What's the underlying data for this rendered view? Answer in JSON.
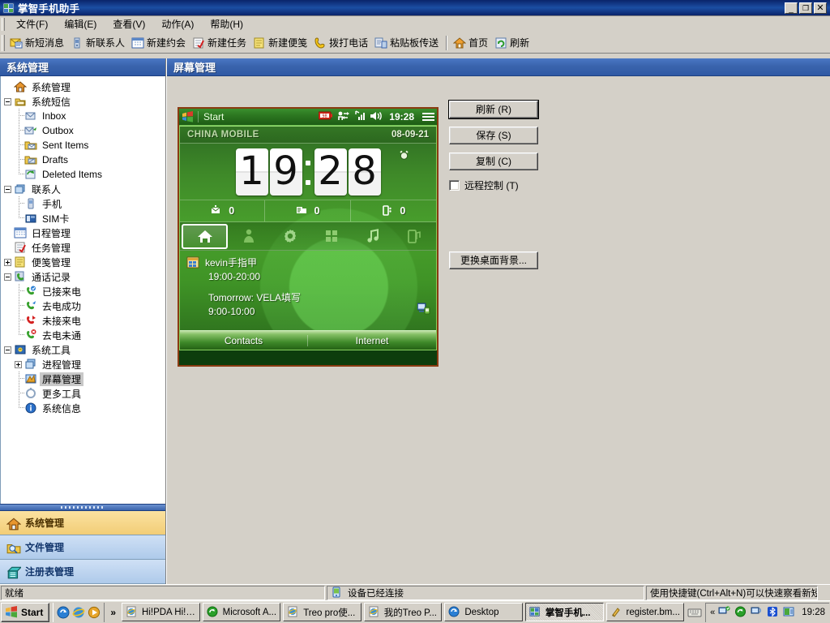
{
  "window": {
    "title": "掌智手机助手",
    "icon": "app-icon",
    "buttons": {
      "minimize": "_",
      "maximize": "❐",
      "close": "✕"
    }
  },
  "menubar": {
    "items": [
      {
        "label": "文件(F)",
        "name": "menu-file"
      },
      {
        "label": "编辑(E)",
        "name": "menu-edit"
      },
      {
        "label": "查看(V)",
        "name": "menu-view"
      },
      {
        "label": "动作(A)",
        "name": "menu-action"
      },
      {
        "label": "帮助(H)",
        "name": "menu-help"
      }
    ]
  },
  "toolbar": {
    "items": [
      {
        "label": "新短消息",
        "icon": "new-sms-icon"
      },
      {
        "label": "新联系人",
        "icon": "new-contact-icon"
      },
      {
        "label": "新建约会",
        "icon": "new-appointment-icon"
      },
      {
        "label": "新建任务",
        "icon": "new-task-icon"
      },
      {
        "label": "新建便笺",
        "icon": "new-note-icon"
      },
      {
        "label": "拨打电话",
        "icon": "dial-phone-icon"
      },
      {
        "label": "粘贴板传送",
        "icon": "clipboard-transfer-icon"
      },
      {
        "label": "首页",
        "icon": "home-icon"
      },
      {
        "label": "刷新",
        "icon": "refresh-icon"
      }
    ]
  },
  "sidebar": {
    "header": "系统管理",
    "tree": [
      {
        "label": "系统管理",
        "indent": 1,
        "icon": "home-house-icon",
        "expander": "none",
        "selected": false
      },
      {
        "label": "系统短信",
        "indent": 1,
        "icon": "sms-folder-icon",
        "expander": "minus",
        "selected": false
      },
      {
        "label": "Inbox",
        "indent": 2,
        "icon": "inbox-icon",
        "expander": "none",
        "selected": false
      },
      {
        "label": "Outbox",
        "indent": 2,
        "icon": "outbox-icon",
        "expander": "none",
        "selected": false
      },
      {
        "label": "Sent Items",
        "indent": 2,
        "icon": "sent-items-icon",
        "expander": "none",
        "selected": false
      },
      {
        "label": "Drafts",
        "indent": 2,
        "icon": "drafts-icon",
        "expander": "none",
        "selected": false
      },
      {
        "label": "Deleted Items",
        "indent": 2,
        "icon": "deleted-items-icon",
        "expander": "none",
        "selected": false
      },
      {
        "label": "联系人",
        "indent": 1,
        "icon": "contacts-icon",
        "expander": "minus",
        "selected": false
      },
      {
        "label": "手机",
        "indent": 2,
        "icon": "phone-icon",
        "expander": "none",
        "selected": false
      },
      {
        "label": "SIM卡",
        "indent": 2,
        "icon": "sim-card-icon",
        "expander": "none",
        "selected": false
      },
      {
        "label": "日程管理",
        "indent": 1,
        "icon": "calendar-icon",
        "expander": "none",
        "selected": false
      },
      {
        "label": "任务管理",
        "indent": 1,
        "icon": "task-icon",
        "expander": "none",
        "selected": false
      },
      {
        "label": "便笺管理",
        "indent": 1,
        "icon": "note-icon",
        "expander": "plus",
        "selected": false
      },
      {
        "label": "通话记录",
        "indent": 1,
        "icon": "call-log-icon",
        "expander": "minus",
        "selected": false
      },
      {
        "label": "已接来电",
        "indent": 2,
        "icon": "call-received-icon",
        "expander": "none",
        "selected": false
      },
      {
        "label": "去电成功",
        "indent": 2,
        "icon": "call-dialed-icon",
        "expander": "none",
        "selected": false
      },
      {
        "label": "未接来电",
        "indent": 2,
        "icon": "call-missed-icon",
        "expander": "none",
        "selected": false
      },
      {
        "label": "去电未通",
        "indent": 2,
        "icon": "call-failed-icon",
        "expander": "none",
        "selected": false
      },
      {
        "label": "系统工具",
        "indent": 1,
        "icon": "system-tools-icon",
        "expander": "minus",
        "selected": false
      },
      {
        "label": "进程管理",
        "indent": 2,
        "icon": "process-manager-icon",
        "expander": "plus",
        "selected": false
      },
      {
        "label": "屏幕管理",
        "indent": 2,
        "icon": "screen-manager-icon",
        "expander": "none",
        "selected": true
      },
      {
        "label": "更多工具",
        "indent": 2,
        "icon": "more-tools-icon",
        "expander": "none",
        "selected": false
      },
      {
        "label": "系统信息",
        "indent": 2,
        "icon": "system-info-icon",
        "expander": "none",
        "selected": false
      }
    ],
    "panels": [
      {
        "label": "系统管理",
        "icon": "house-icon",
        "active": true
      },
      {
        "label": "文件管理",
        "icon": "folder-search-icon",
        "active": false
      },
      {
        "label": "注册表管理",
        "icon": "registry-icon",
        "active": false
      }
    ]
  },
  "content": {
    "header": "屏幕管理",
    "buttons": [
      {
        "label": "刷新 (R)",
        "name": "refresh-button",
        "default": true
      },
      {
        "label": "保存 (S)",
        "name": "save-button",
        "default": false
      },
      {
        "label": "复制 (C)",
        "name": "copy-button",
        "default": false
      }
    ],
    "checkbox": {
      "label": "远程控制 (T)",
      "checked": false
    },
    "wallpaper_button": "更换桌面背景..."
  },
  "phone_screen": {
    "status_bar": {
      "start_label": "Start",
      "time": "19:28",
      "icons": [
        "battery-icon",
        "connectivity-icon",
        "signal-icon",
        "volume-icon",
        "menu-icon"
      ],
      "battery_text": "98"
    },
    "carrier": "CHINA MOBILE",
    "date": "08-09-21",
    "clock": {
      "hours": "19",
      "minutes": "28",
      "digits": [
        "1",
        "9",
        "2",
        "8"
      ]
    },
    "counters": [
      {
        "icon": "email-icon",
        "value": "0"
      },
      {
        "icon": "sms-icon",
        "value": "0"
      },
      {
        "icon": "missed-call-icon",
        "value": "0"
      }
    ],
    "nav_icons": [
      {
        "name": "home-tab-icon",
        "selected": true
      },
      {
        "name": "people-tab-icon",
        "selected": false
      },
      {
        "name": "settings-tab-icon",
        "selected": false
      },
      {
        "name": "programs-tab-icon",
        "selected": false
      },
      {
        "name": "music-tab-icon",
        "selected": false
      },
      {
        "name": "media-tab-icon",
        "selected": false
      }
    ],
    "appointments": [
      {
        "title": "kevin手指甲",
        "time": "19:00-20:00"
      },
      {
        "title": "Tomorrow: VELA填写",
        "time": "9:00-10:00"
      }
    ],
    "softkeys": {
      "left": "Contacts",
      "right": "Internet"
    }
  },
  "statusbar": {
    "ready": "就绪",
    "connection": "设备已经连接",
    "hint": "使用快捷键(Ctrl+Alt+N)可以快速察看新短信"
  },
  "taskbar": {
    "start": "Start",
    "quick_launch": [
      "show-desktop-icon",
      "internet-explorer-icon",
      "media-player-icon"
    ],
    "overflow": "»",
    "tasks": [
      {
        "label": "Hi!PDA Hi!P...",
        "icon": "ie-icon",
        "active": false
      },
      {
        "label": "Microsoft A...",
        "icon": "activesync-icon",
        "active": false
      },
      {
        "label": "Treo pro使...",
        "icon": "ie-icon",
        "active": false
      },
      {
        "label": "我的Treo P...",
        "icon": "ie-icon",
        "active": false
      },
      {
        "label": "Desktop",
        "icon": "explorer-icon",
        "active": false
      },
      {
        "label": "掌智手机...",
        "icon": "app-icon",
        "active": true
      },
      {
        "label": "register.bm...",
        "icon": "paint-icon",
        "active": false
      }
    ],
    "tray": {
      "chevron": "«",
      "icons": [
        "network-icon",
        "activesync-tray-icon",
        "monitor-icon",
        "bluetooth-icon",
        "device-icon"
      ],
      "clock": "19:28"
    }
  },
  "colors": {
    "title_blue": "#0a246a",
    "header_blue": "#3a64ad",
    "panel_active": "#f2cd77",
    "panel_blue": "#b9d0ee",
    "face": "#d4d0c8",
    "phone_green": "#49a02c"
  }
}
